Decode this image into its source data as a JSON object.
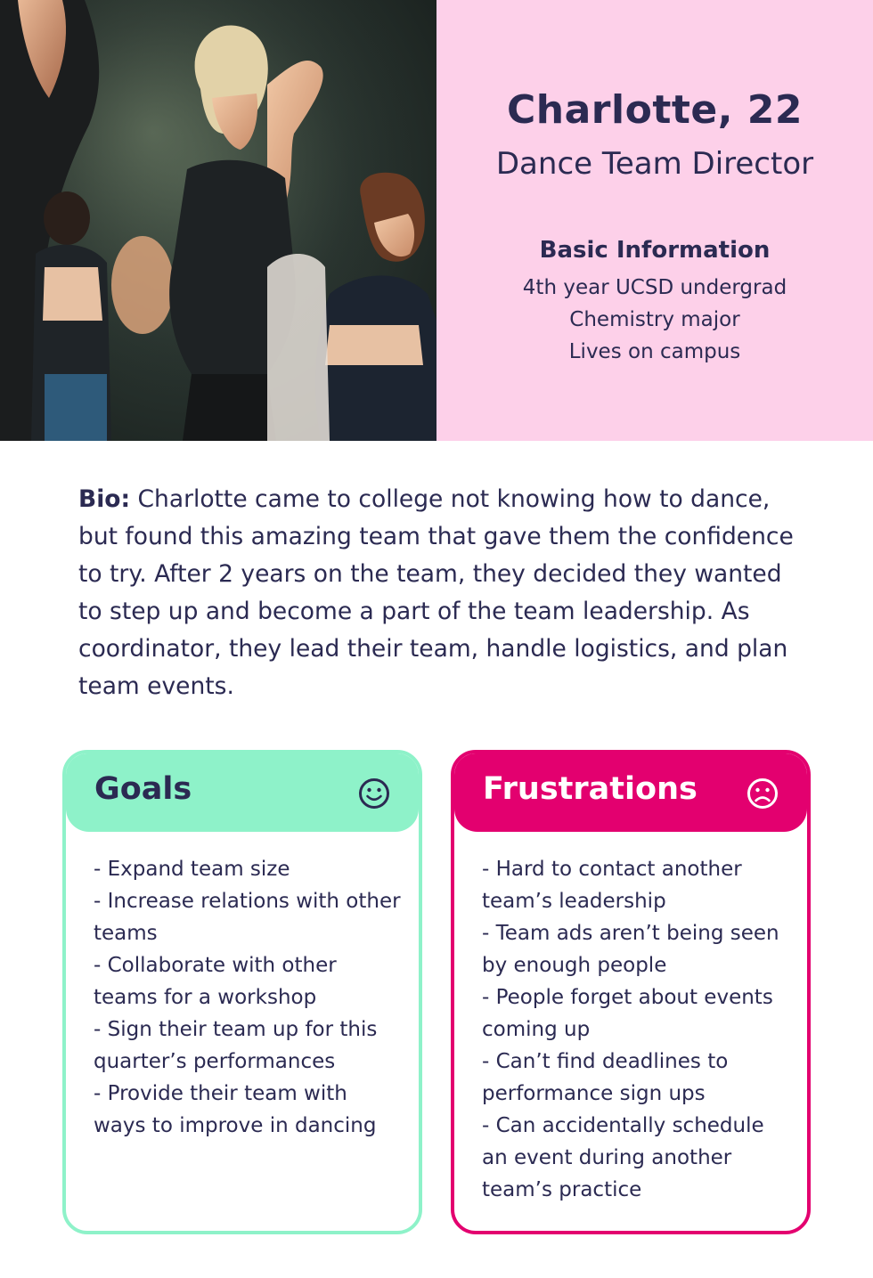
{
  "persona": {
    "name": "Charlotte, 22",
    "role": "Dance Team Director"
  },
  "basic_info": {
    "heading": "Basic Information",
    "items": [
      "4th year UCSD undergrad",
      "Chemistry major",
      "Lives on campus"
    ]
  },
  "bio": {
    "label": "Bio:",
    "text": "Charlotte came to college not knowing how to dance, but found this amazing team that gave them the confidence to try. After 2 years on the team, they decided they wanted to step up and become a part of the team leadership. As coordinator, they lead their team, handle logistics, and plan team events."
  },
  "goals": {
    "title": "Goals",
    "icon": "smile-icon",
    "items": [
      "- Expand team size",
      "- Increase relations with other teams",
      "- Collaborate with other teams for a workshop",
      "- Sign their team up for this quarter’s performances",
      "- Provide their team with ways to improve in dancing"
    ]
  },
  "frustrations": {
    "title": "Frustrations",
    "icon": "frown-icon",
    "items": [
      "- Hard to contact another team’s leadership",
      "- Team ads aren’t being seen by enough people",
      "- People forget about events coming up",
      "- Can’t find deadlines to performance sign ups",
      "- Can accidentally schedule an event during another team’s practice"
    ]
  },
  "colors": {
    "pink_panel": "#fdd0e9",
    "navy_text": "#2b2a52",
    "goals_green": "#8ef2c9",
    "frustrations_magenta": "#e3006f"
  }
}
